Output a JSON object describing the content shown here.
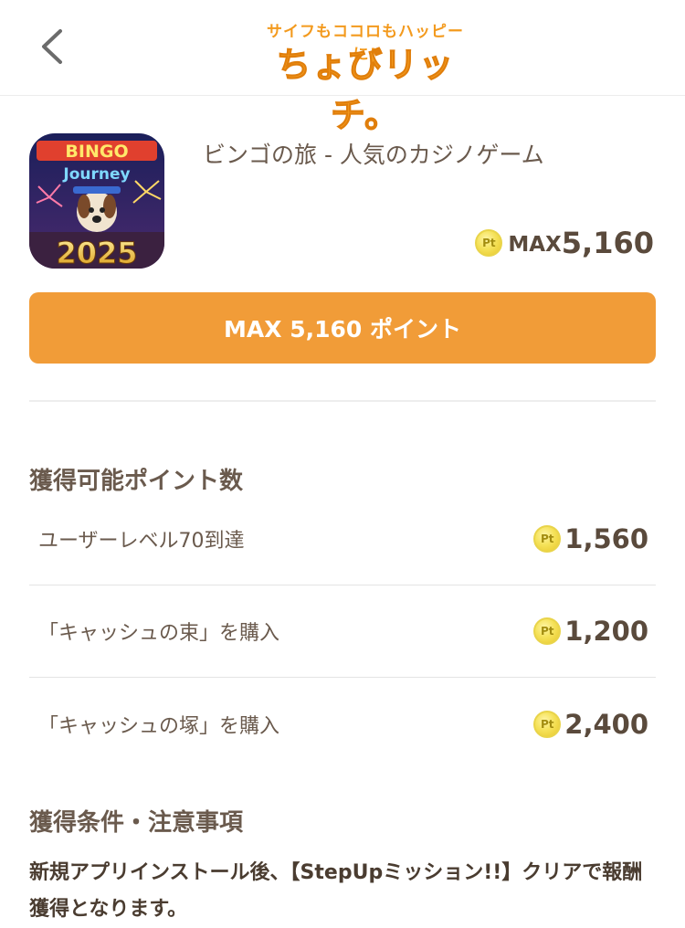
{
  "header": {
    "logo_tagline": "サイフもココロもハッピーに!",
    "logo_name": "ちょびリッチ。"
  },
  "app": {
    "title": "ビンゴの旅 - 人気のカジノゲーム",
    "icon_text": {
      "line1": "BINGO",
      "line2": "Journey",
      "year": "2025"
    },
    "max_prefix": "MAX",
    "max_value": "5,160",
    "coin_label": "Pt"
  },
  "cta": {
    "label": "MAX 5,160 ポイント"
  },
  "points_section": {
    "title": "獲得可能ポイント数",
    "items": [
      {
        "label": "ユーザーレベル70到達",
        "points": "1,560"
      },
      {
        "label": "「キャッシュの束」を購入",
        "points": "1,200"
      },
      {
        "label": "「キャッシュの塚」を購入",
        "points": "2,400"
      }
    ]
  },
  "notes_section": {
    "title": "獲得条件・注意事項",
    "text": "新規アプリインストール後、【StepUpミッション!!】クリアで報酬獲得となります。"
  }
}
